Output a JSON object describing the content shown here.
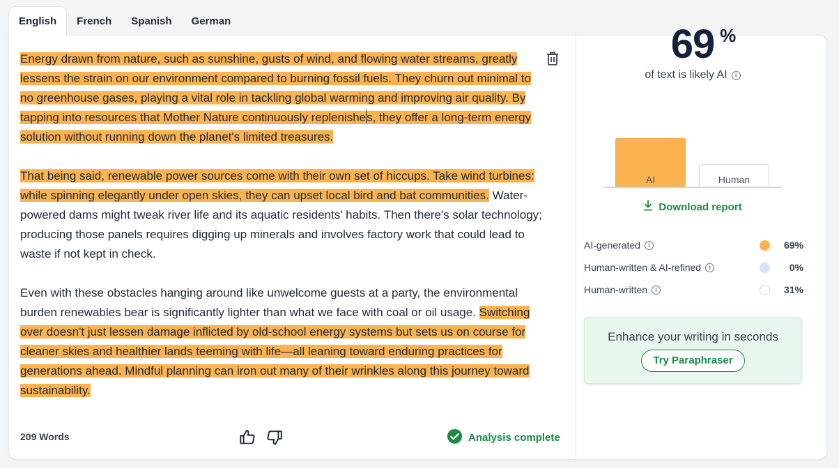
{
  "tabs": [
    {
      "label": "English",
      "active": true
    },
    {
      "label": "French",
      "active": false
    },
    {
      "label": "Spanish",
      "active": false
    },
    {
      "label": "German",
      "active": false
    }
  ],
  "editor": {
    "p1_hl_a": "Energy drawn from nature, such as sunshine, gusts of wind, and flowing water streams, greatly lessens the strain on our environment compared to burning fossil fuels. They churn out minimal to no greenhouse gases, playing a vital role in tackling global warming and improving air quality. By tapping into resources that Mother Nature continuously replenishe",
    "p1_hl_b": "s, they offer a long-term energy solution without running down the planet's limited treasures.",
    "p2_hl": "That being said, renewable power sources come with their own set of hiccups. Take wind turbines: while spinning elegantly under open skies, they can upset local bird and bat communities.",
    "p2_plain": " Water-powered dams might tweak river life and its aquatic residents' habits. Then there's solar technology; producing those panels requires digging up minerals and involves factory work that could lead to waste if not kept in check.",
    "p3_plain": "Even with these obstacles hanging around like unwelcome guests at a party, the environmental burden renewables bear is significantly lighter than what we face with coal or oil usage. ",
    "p3_hl": "Switching over doesn't just lessen damage inflicted by old-school energy systems but sets us on course for cleaner skies and healthier lands teeming with life—all leaning toward enduring practices for generations ahead. Mindful planning can iron out many of their wrinkles along this journey toward sustainability."
  },
  "footer": {
    "word_count": "209 Words",
    "status": "Analysis complete"
  },
  "result": {
    "score": "69",
    "score_unit": "%",
    "score_caption": "of text is likely AI",
    "bars": {
      "ai_label": "AI",
      "human_label": "Human",
      "ai_fraction": 0.69,
      "human_fraction": 0.31
    },
    "download_label": "Download report",
    "legend": [
      {
        "label": "AI-generated",
        "value": "69%",
        "color": "#fbb251"
      },
      {
        "label": "Human-written & AI-refined",
        "value": "0%",
        "color": "#d6e4fb"
      },
      {
        "label": "Human-written",
        "value": "31%",
        "color": "#ffffff"
      }
    ]
  },
  "promo": {
    "text": "Enhance your writing in seconds",
    "button": "Try Paraphraser"
  },
  "colors": {
    "highlight": "#fbb251",
    "accent_green": "#1a8a45",
    "score_text": "#14213d"
  },
  "icons": [
    "trash-icon",
    "thumbs-up-icon",
    "thumbs-down-icon",
    "check-circle-icon",
    "info-icon",
    "download-icon"
  ]
}
